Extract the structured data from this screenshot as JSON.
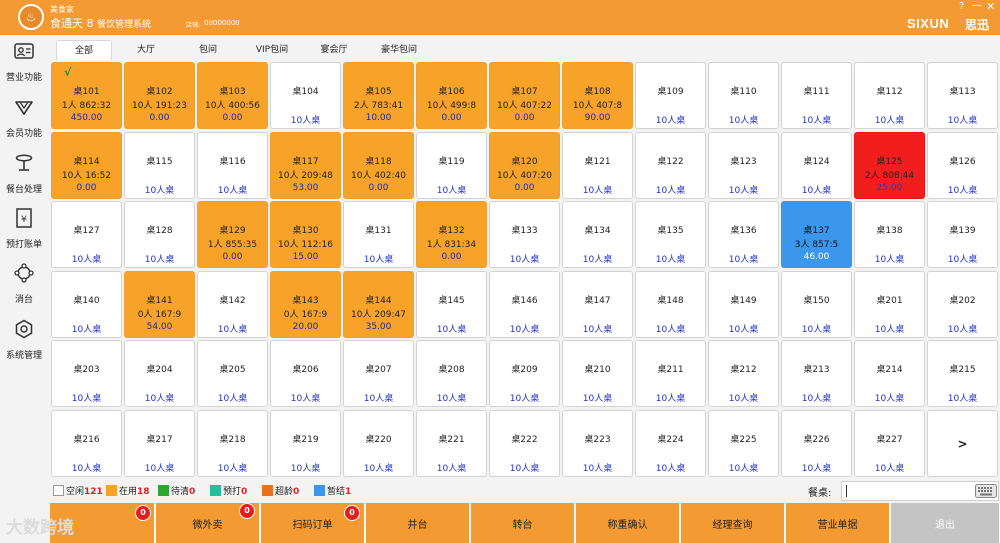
{
  "titlebar": {
    "brand": "美食家",
    "app_title": "食通天 8",
    "app_subtitle": "餐饮管理系统",
    "store_label": "店铺:",
    "store_code": "00000000",
    "logo_text": "SIXUN",
    "logo_cn": "思迅",
    "help": "?",
    "minimize": "—",
    "close": "✕"
  },
  "sidebar": {
    "items": [
      {
        "label": "营业功能",
        "icon": "business-card-icon"
      },
      {
        "label": "会员功能",
        "icon": "diamond-icon"
      },
      {
        "label": "餐台处理",
        "icon": "dining-table-icon"
      },
      {
        "label": "预打账单",
        "icon": "bill-icon"
      },
      {
        "label": "消台",
        "icon": "clear-table-icon"
      },
      {
        "label": "系统管理",
        "icon": "settings-icon"
      }
    ]
  },
  "tabs": [
    "全部",
    "大厅",
    "包间",
    "VIP包间",
    "宴会厅",
    "豪华包间"
  ],
  "tables": [
    {
      "name": "桌101",
      "status": "inuse",
      "info": "1人 862:32",
      "amount": "450.00",
      "check": true
    },
    {
      "name": "桌102",
      "status": "inuse",
      "info": "10人 191:23",
      "amount": "0.00"
    },
    {
      "name": "桌103",
      "status": "inuse",
      "info": "10人 400:56",
      "amount": "0.00"
    },
    {
      "name": "桌104",
      "status": "free",
      "capacity": "10人桌"
    },
    {
      "name": "桌105",
      "status": "inuse",
      "info": "2人 783:41",
      "amount": "10.00"
    },
    {
      "name": "桌106",
      "status": "inuse",
      "info": "10人 499:8",
      "amount": "0.00"
    },
    {
      "name": "桌107",
      "status": "inuse",
      "info": "10人 407:22",
      "amount": "0.00"
    },
    {
      "name": "桌108",
      "status": "inuse",
      "info": "10人 407:8",
      "amount": "90.00"
    },
    {
      "name": "桌109",
      "status": "free",
      "capacity": "10人桌"
    },
    {
      "name": "桌110",
      "status": "free",
      "capacity": "10人桌"
    },
    {
      "name": "桌111",
      "status": "free",
      "capacity": "10人桌"
    },
    {
      "name": "桌112",
      "status": "free",
      "capacity": "10人桌"
    },
    {
      "name": "桌113",
      "status": "free",
      "capacity": "10人桌"
    },
    {
      "name": "桌114",
      "status": "inuse",
      "info": "10人 16:52",
      "amount": "0.00"
    },
    {
      "name": "桌115",
      "status": "free",
      "capacity": "10人桌"
    },
    {
      "name": "桌116",
      "status": "free",
      "capacity": "10人桌"
    },
    {
      "name": "桌117",
      "status": "inuse",
      "info": "10人 209:48",
      "amount": "53.00"
    },
    {
      "name": "桌118",
      "status": "inuse",
      "info": "10人 402:40",
      "amount": "0.00"
    },
    {
      "name": "桌119",
      "status": "free",
      "capacity": "10人桌"
    },
    {
      "name": "桌120",
      "status": "inuse",
      "info": "10人 407:20",
      "amount": "0.00"
    },
    {
      "name": "桌121",
      "status": "free",
      "capacity": "10人桌"
    },
    {
      "name": "桌122",
      "status": "free",
      "capacity": "10人桌"
    },
    {
      "name": "桌123",
      "status": "free",
      "capacity": "10人桌"
    },
    {
      "name": "桌124",
      "status": "free",
      "capacity": "10人桌"
    },
    {
      "name": "桌125",
      "status": "red",
      "info": "2人 808:44",
      "amount": "25.00"
    },
    {
      "name": "桌126",
      "status": "free",
      "capacity": "10人桌"
    },
    {
      "name": "桌127",
      "status": "free",
      "capacity": "10人桌"
    },
    {
      "name": "桌128",
      "status": "free",
      "capacity": "10人桌"
    },
    {
      "name": "桌129",
      "status": "inuse",
      "info": "1人 855:35",
      "amount": "0.00"
    },
    {
      "name": "桌130",
      "status": "inuse",
      "info": "10人 112:16",
      "amount": "15.00"
    },
    {
      "name": "桌131",
      "status": "free",
      "capacity": "10人桌"
    },
    {
      "name": "桌132",
      "status": "inuse",
      "info": "1人 831:34",
      "amount": "0.00"
    },
    {
      "name": "桌133",
      "status": "free",
      "capacity": "10人桌"
    },
    {
      "name": "桌134",
      "status": "free",
      "capacity": "10人桌"
    },
    {
      "name": "桌135",
      "status": "free",
      "capacity": "10人桌"
    },
    {
      "name": "桌136",
      "status": "free",
      "capacity": "10人桌"
    },
    {
      "name": "桌137",
      "status": "blue",
      "info": "3人 857:5",
      "amount": "46.00"
    },
    {
      "name": "桌138",
      "status": "free",
      "capacity": "10人桌"
    },
    {
      "name": "桌139",
      "status": "free",
      "capacity": "10人桌"
    },
    {
      "name": "桌140",
      "status": "free",
      "capacity": "10人桌"
    },
    {
      "name": "桌141",
      "status": "inuse",
      "info": "0人 167:9",
      "amount": "54.00"
    },
    {
      "name": "桌142",
      "status": "free",
      "capacity": "10人桌"
    },
    {
      "name": "桌143",
      "status": "inuse",
      "info": "0人 167:9",
      "amount": "20.00"
    },
    {
      "name": "桌144",
      "status": "inuse",
      "info": "10人 209:47",
      "amount": "35.00"
    },
    {
      "name": "桌145",
      "status": "free",
      "capacity": "10人桌"
    },
    {
      "name": "桌146",
      "status": "free",
      "capacity": "10人桌"
    },
    {
      "name": "桌147",
      "status": "free",
      "capacity": "10人桌"
    },
    {
      "name": "桌148",
      "status": "free",
      "capacity": "10人桌"
    },
    {
      "name": "桌149",
      "status": "free",
      "capacity": "10人桌"
    },
    {
      "name": "桌150",
      "status": "free",
      "capacity": "10人桌"
    },
    {
      "name": "桌201",
      "status": "free",
      "capacity": "10人桌"
    },
    {
      "name": "桌202",
      "status": "free",
      "capacity": "10人桌"
    },
    {
      "name": "桌203",
      "status": "free",
      "capacity": "10人桌"
    },
    {
      "name": "桌204",
      "status": "free",
      "capacity": "10人桌"
    },
    {
      "name": "桌205",
      "status": "free",
      "capacity": "10人桌"
    },
    {
      "name": "桌206",
      "status": "free",
      "capacity": "10人桌"
    },
    {
      "name": "桌207",
      "status": "free",
      "capacity": "10人桌"
    },
    {
      "name": "桌208",
      "status": "free",
      "capacity": "10人桌"
    },
    {
      "name": "桌209",
      "status": "free",
      "capacity": "10人桌"
    },
    {
      "name": "桌210",
      "status": "free",
      "capacity": "10人桌"
    },
    {
      "name": "桌211",
      "status": "free",
      "capacity": "10人桌"
    },
    {
      "name": "桌212",
      "status": "free",
      "capacity": "10人桌"
    },
    {
      "name": "桌213",
      "status": "free",
      "capacity": "10人桌"
    },
    {
      "name": "桌214",
      "status": "free",
      "capacity": "10人桌"
    },
    {
      "name": "桌215",
      "status": "free",
      "capacity": "10人桌"
    },
    {
      "name": "桌216",
      "status": "free",
      "capacity": "10人桌"
    },
    {
      "name": "桌217",
      "status": "free",
      "capacity": "10人桌"
    },
    {
      "name": "桌218",
      "status": "free",
      "capacity": "10人桌"
    },
    {
      "name": "桌219",
      "status": "free",
      "capacity": "10人桌"
    },
    {
      "name": "桌220",
      "status": "free",
      "capacity": "10人桌"
    },
    {
      "name": "桌221",
      "status": "free",
      "capacity": "10人桌"
    },
    {
      "name": "桌222",
      "status": "free",
      "capacity": "10人桌"
    },
    {
      "name": "桌223",
      "status": "free",
      "capacity": "10人桌"
    },
    {
      "name": "桌224",
      "status": "free",
      "capacity": "10人桌"
    },
    {
      "name": "桌225",
      "status": "free",
      "capacity": "10人桌"
    },
    {
      "name": "桌226",
      "status": "free",
      "capacity": "10人桌"
    },
    {
      "name": "桌227",
      "status": "free",
      "capacity": "10人桌"
    }
  ],
  "next_page": ">",
  "legend": [
    {
      "label": "空闲",
      "count": "121",
      "color": "#ffffff"
    },
    {
      "label": "在用",
      "count": "18",
      "color": "#f7a32a"
    },
    {
      "label": "待清",
      "count": "0",
      "color": "#2ea52e"
    },
    {
      "label": "预打",
      "count": "0",
      "color": "#22c09a"
    },
    {
      "label": "超龄",
      "count": "0",
      "color": "#e8731c"
    },
    {
      "label": "暂结",
      "count": "1",
      "color": "#3b97ec"
    }
  ],
  "order_search": {
    "label": "餐桌:",
    "value": ""
  },
  "bottom_buttons": [
    {
      "label": "",
      "badge": "0"
    },
    {
      "label": "微外卖",
      "badge": "0"
    },
    {
      "label": "扫码订单",
      "badge": "0"
    },
    {
      "label": "并台"
    },
    {
      "label": "转台"
    },
    {
      "label": "称重确认"
    },
    {
      "label": "经理查询"
    },
    {
      "label": "营业单据"
    },
    {
      "label": "退出"
    }
  ],
  "watermark": "大数跨境",
  "colors": {
    "accent": "#f49a33",
    "inuse": "#f7a32a",
    "alert": "#f21d1d",
    "settle": "#3b97ec"
  }
}
